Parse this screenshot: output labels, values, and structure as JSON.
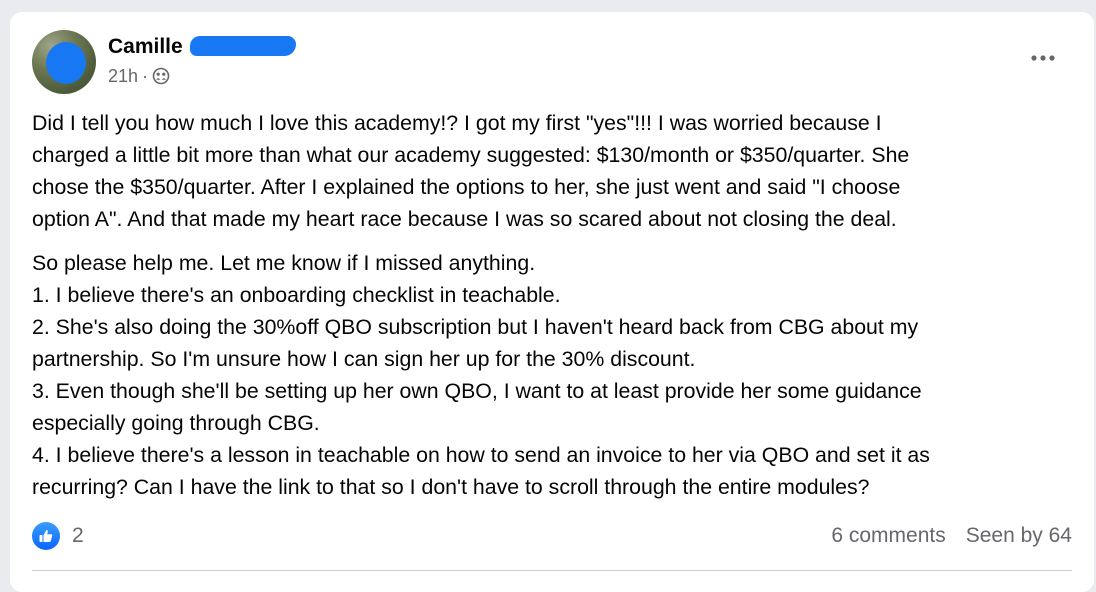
{
  "post": {
    "author": "Camille",
    "time": "21h",
    "separator": "·",
    "audience_icon": "group-icon",
    "more_icon": "ellipsis-icon",
    "paragraphs": [
      [
        "Did I tell you how much I love this academy!?  I got my first \"yes\"!!! I was worried because I",
        "charged a little bit more than what our academy suggested: $130/month or $350/quarter. She",
        "chose the $350/quarter. After I explained the options to her, she just went and said \"I choose",
        "option A\". And that made my heart race because I was so scared about not closing the deal."
      ],
      [
        "So please help me. Let me know if I missed anything.",
        "1. I believe there's an onboarding checklist in teachable.",
        "2. She's also doing the 30%off QBO subscription but I haven't heard back from CBG about my",
        "partnership. So I'm unsure how I can sign her up for the 30% discount.",
        "3. Even though she'll be setting up her own QBO, I want to at least provide her some guidance",
        "especially going through CBG.",
        "4. I believe there's a lesson in teachable on how to send an invoice to her via QBO and set it as",
        "recurring? Can I have the link to that so I don't have to scroll through the entire modules?"
      ]
    ]
  },
  "footer": {
    "like_icon": "thumbs-up-icon",
    "reaction_count": "2",
    "comments": "6 comments",
    "seen_by": "Seen by 64"
  },
  "colors": {
    "accent": "#1877f2",
    "text": "#050505",
    "secondary_text": "#65676b",
    "background": "#e9ebee",
    "card": "#ffffff"
  }
}
